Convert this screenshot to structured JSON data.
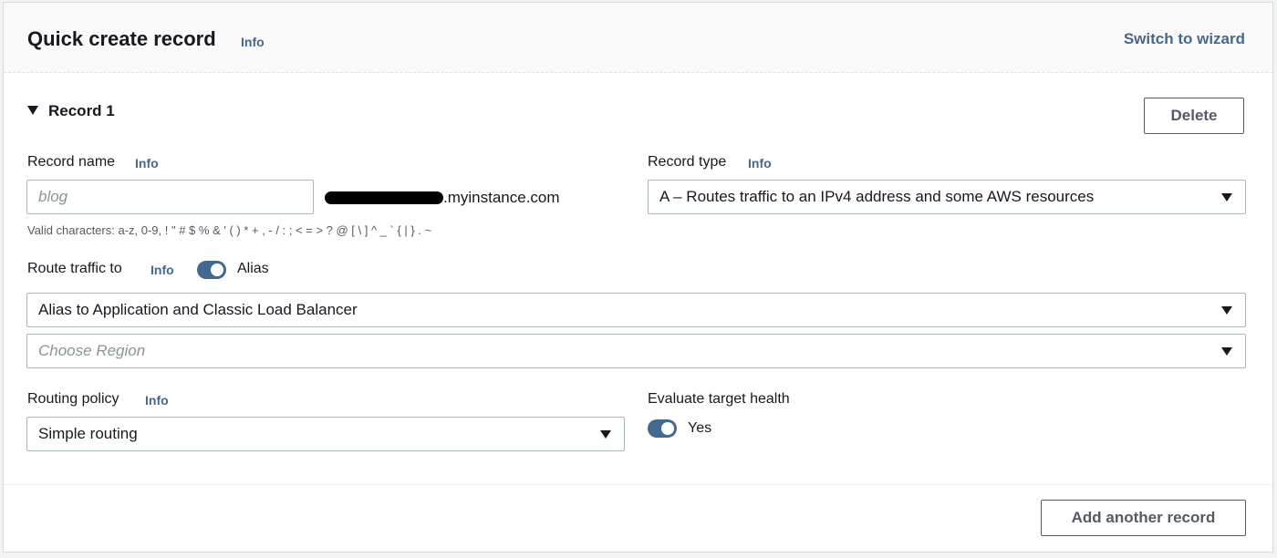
{
  "header": {
    "title": "Quick create record",
    "info": "Info",
    "switch_link": "Switch to wizard"
  },
  "record": {
    "heading": "Record 1",
    "delete_label": "Delete",
    "record_name": {
      "label": "Record name",
      "info": "Info",
      "placeholder": "blog",
      "domain_suffix": ".myinstance.com",
      "hint": "Valid characters: a-z, 0-9, ! \" # $ % & ' ( ) * + , - / : ; < = > ? @ [ \\ ] ^ _ ` { | } . ~"
    },
    "record_type": {
      "label": "Record type",
      "info": "Info",
      "value": "A – Routes traffic to an IPv4 address and some AWS resources"
    },
    "route_traffic": {
      "label": "Route traffic to",
      "info": "Info",
      "toggle_label": "Alias",
      "toggle_on": true,
      "endpoint": "Alias to Application and Classic Load Balancer",
      "region_placeholder": "Choose Region"
    },
    "routing_policy": {
      "label": "Routing policy",
      "info": "Info",
      "value": "Simple routing"
    },
    "evaluate_health": {
      "label": "Evaluate target health",
      "toggle_label": "Yes",
      "toggle_on": true
    }
  },
  "footer": {
    "add_label": "Add another record"
  }
}
